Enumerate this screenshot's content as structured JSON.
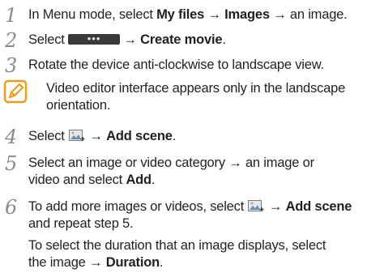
{
  "steps": [
    {
      "number": "1",
      "line1_pre": "In Menu mode, select ",
      "line1_b1": "My files",
      "line1_arrow1": " → ",
      "line1_b2": "Images",
      "line1_post": " → an image."
    },
    {
      "number": "2",
      "pre": "Select ",
      "button_dots": "•••",
      "arrow": " → ",
      "bold": "Create movie",
      "post": "."
    },
    {
      "number": "3",
      "text": "Rotate the device anti-clockwise to landscape view."
    },
    {
      "note_line1": "Video editor interface appears only in the landscape",
      "note_line2": "orientation."
    },
    {
      "number": "4",
      "pre": "Select ",
      "arrow": " → ",
      "bold": "Add scene",
      "post": "."
    },
    {
      "number": "5",
      "line1": "Select an image or video category → an image or",
      "line2_pre": "video and select ",
      "line2_bold": "Add",
      "line2_post": "."
    },
    {
      "number": "6",
      "line1_pre": "To add more images or videos, select ",
      "line1_arrow": " → ",
      "line1_bold": "Add scene",
      "line2": "and repeat step 5.",
      "line3": "To select the duration that an image displays, select",
      "line4_pre": "the image → ",
      "line4_bold": "Duration",
      "line4_post": "."
    }
  ],
  "icons": {
    "note": "pencil-note-icon",
    "image_add": "image-add-icon"
  },
  "colors": {
    "text": "#231f20",
    "step_number": "#8a8a8a",
    "note_accent": "#f39a1c"
  }
}
